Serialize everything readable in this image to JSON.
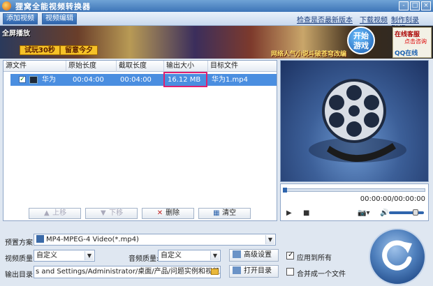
{
  "window": {
    "title": "狸窝全能视频转换器",
    "controls": [
      "-",
      "□",
      "×"
    ]
  },
  "toolbar": {
    "add_video": "添加视频",
    "edit_video": "视频编辑",
    "links": [
      "检查是否最新版本",
      "下载视频",
      "制作刻录DVD"
    ]
  },
  "banner": {
    "ad_label": "全屏播放",
    "chips": [
      "试玩30秒",
      "留意今夕"
    ],
    "slogan": "网络人气小说斗破苍穹改编",
    "start_game": "开始\n游戏",
    "cs_top": "在线客服",
    "cs_mid": "点击咨询",
    "cs_qq": "QQ在线"
  },
  "file_list": {
    "columns": [
      "源文件",
      "原始长度",
      "截取长度",
      "输出大小",
      "目标文件"
    ],
    "rows": [
      {
        "checked": true,
        "source": "华为1....",
        "orig_len": "00:04:00",
        "cut_len": "00:04:00",
        "out_size": "16.12 MB",
        "target": "华为1.mp4"
      }
    ],
    "buttons": {
      "up": "上移",
      "down": "下移",
      "delete": "删除",
      "clear": "清空"
    }
  },
  "player": {
    "timecode": "00:00:00/00:00:00",
    "progress": 0,
    "volume": 0.75
  },
  "settings": {
    "preset_label": "预置方案:",
    "preset_value": "MP4-MPEG-4 Video(*.mp4)",
    "video_quality_label": "视频质量:",
    "video_quality_value": "自定义",
    "audio_quality_label": "音频质量:",
    "audio_quality_value": "自定义",
    "advanced_button": "高级设置",
    "apply_all_label": "应用到所有",
    "apply_all_checked": true,
    "output_dir_label": "输出目录:",
    "output_dir_value": "s and Settings/Administrator/桌面/产品/问题实例和视频原件/转换",
    "open_dir_button": "打开目录",
    "merge_label": "合并成一个文件",
    "merge_checked": false
  },
  "colors": {
    "title_bar": "#3d74b7",
    "row_selected": "#4a8ee0",
    "highlight": "#e0206e"
  }
}
